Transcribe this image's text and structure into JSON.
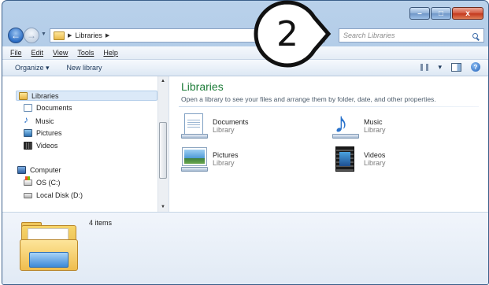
{
  "window": {
    "caption": {
      "minimize": "–",
      "maximize": "□",
      "close": "x"
    }
  },
  "nav": {
    "address_path": "Libraries",
    "search_placeholder": "Search Libraries"
  },
  "menu": {
    "file": "File",
    "edit": "Edit",
    "view": "View",
    "tools": "Tools",
    "help": "Help"
  },
  "commands": {
    "organize": "Organize ▾",
    "new_library": "New library",
    "views_caret": "▾",
    "help_glyph": "?"
  },
  "sidebar": {
    "libraries": "Libraries",
    "documents": "Documents",
    "music": "Music",
    "pictures": "Pictures",
    "videos": "Videos",
    "computer": "Computer",
    "os_drive": "OS (C:)",
    "local_disk": "Local Disk (D:)"
  },
  "content": {
    "title": "Libraries",
    "subtitle": "Open a library to see your files and arrange them by folder, date, and other properties.",
    "items": [
      {
        "name": "Documents",
        "type": "Library",
        "icon": "documents-library-icon"
      },
      {
        "name": "Music",
        "type": "Library",
        "icon": "music-library-icon"
      },
      {
        "name": "Pictures",
        "type": "Library",
        "icon": "pictures-library-icon"
      },
      {
        "name": "Videos",
        "type": "Library",
        "icon": "videos-library-icon"
      }
    ]
  },
  "details": {
    "count": "4 items"
  },
  "step_badge": {
    "number": "2"
  },
  "colors": {
    "title_green": "#1e7d3a",
    "selection": "#dbe9f8",
    "close_red": "#c2361c",
    "frame_blue": "#aac6e6"
  }
}
